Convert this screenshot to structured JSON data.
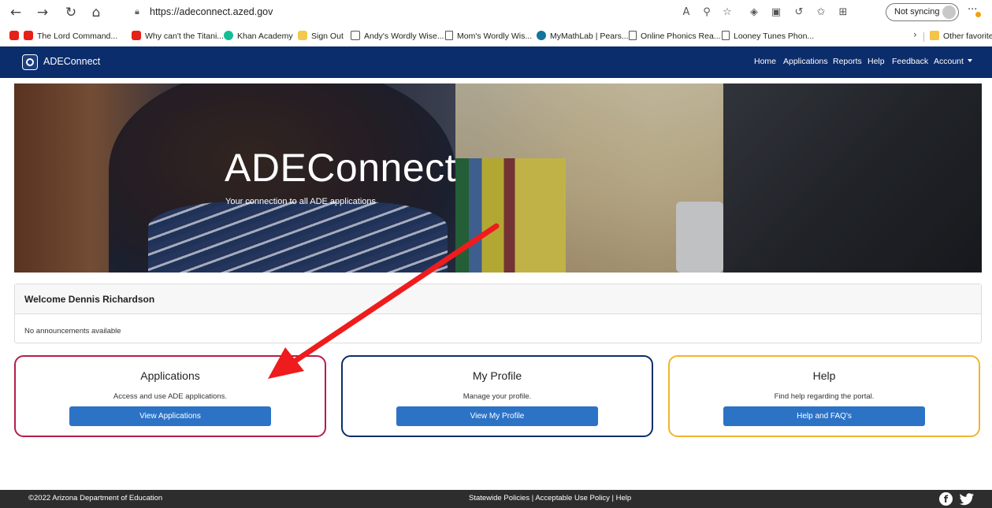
{
  "browser": {
    "url": "https://adeconnect.azed.gov",
    "sync_label": "Not syncing",
    "bookmarks": [
      {
        "label": "The Lord Command...",
        "icon": "youtube-icon"
      },
      {
        "label": "Why can't the Titani...",
        "icon": "youtube-icon"
      },
      {
        "label": "Khan Academy",
        "icon": "khan-academy-icon"
      },
      {
        "label": "Sign Out",
        "icon": "sign-out-icon"
      },
      {
        "label": "Andy's Wordly Wise...",
        "icon": "book-icon"
      },
      {
        "label": "Mom's Wordly Wis...",
        "icon": "page-icon"
      },
      {
        "label": "MyMathLab | Pears...",
        "icon": "pearson-icon"
      },
      {
        "label": "Online Phonics Rea...",
        "icon": "page-icon"
      },
      {
        "label": "Looney Tunes Phon...",
        "icon": "page-icon"
      }
    ],
    "other_favorites": "Other favorites"
  },
  "site_nav": {
    "brand": "ADEConnect",
    "links": [
      "Home",
      "Applications",
      "Reports",
      "Help",
      "Feedback",
      "Account"
    ]
  },
  "hero": {
    "title": "ADEConnect",
    "subtitle": "Your connection to all ADE applications"
  },
  "welcome": {
    "title": "Welcome Dennis Richardson",
    "body": "No announcements available"
  },
  "cards": [
    {
      "title": "Applications",
      "description": "Access and use ADE applications.",
      "button": "View Applications",
      "border_color": "#b51d4a"
    },
    {
      "title": "My Profile",
      "description": "Manage your profile.",
      "button": "View My Profile",
      "border_color": "#0c2d6b"
    },
    {
      "title": "Help",
      "description": "Find help regarding the portal.",
      "button": "Help and FAQ's",
      "border_color": "#f1b52e"
    }
  ],
  "footer": {
    "copyright": "©2022 Arizona Department of Education",
    "links": "Statewide Policies  | Acceptable Use Policy  | Help",
    "social": [
      "facebook-icon",
      "twitter-icon"
    ]
  },
  "colors": {
    "nav_bg": "#0c2d6b",
    "button_blue": "#2c73c6",
    "annotation_arrow": "#ee1c1c",
    "footer_bg": "#2d2d2d"
  }
}
